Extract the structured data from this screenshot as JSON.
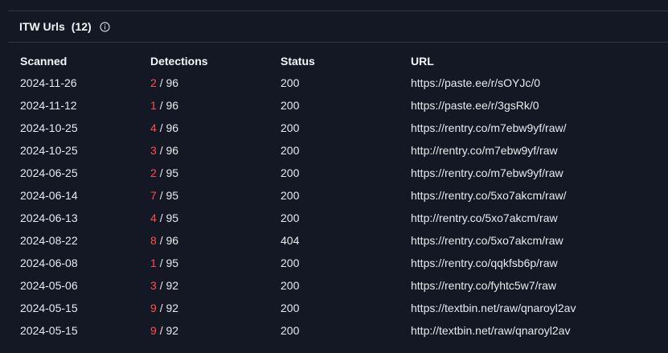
{
  "header": {
    "title": "ITW Urls",
    "count": "(12)",
    "info_icon": "info-circle-icon"
  },
  "table": {
    "columns": [
      "Scanned",
      "Detections",
      "Status",
      "URL"
    ],
    "rows": [
      {
        "scanned": "2024-11-26",
        "det": "2",
        "total": "/ 96",
        "status": "200",
        "url": "https://paste.ee/r/sOYJc/0"
      },
      {
        "scanned": "2024-11-12",
        "det": "1",
        "total": "/ 96",
        "status": "200",
        "url": "https://paste.ee/r/3gsRk/0"
      },
      {
        "scanned": "2024-10-25",
        "det": "4",
        "total": "/ 96",
        "status": "200",
        "url": "https://rentry.co/m7ebw9yf/raw/"
      },
      {
        "scanned": "2024-10-25",
        "det": "3",
        "total": "/ 96",
        "status": "200",
        "url": "http://rentry.co/m7ebw9yf/raw"
      },
      {
        "scanned": "2024-06-25",
        "det": "2",
        "total": "/ 95",
        "status": "200",
        "url": "https://rentry.co/m7ebw9yf/raw"
      },
      {
        "scanned": "2024-06-14",
        "det": "7",
        "total": "/ 95",
        "status": "200",
        "url": "https://rentry.co/5xo7akcm/raw/"
      },
      {
        "scanned": "2024-06-13",
        "det": "4",
        "total": "/ 95",
        "status": "200",
        "url": "http://rentry.co/5xo7akcm/raw"
      },
      {
        "scanned": "2024-08-22",
        "det": "8",
        "total": "/ 96",
        "status": "404",
        "url": "https://rentry.co/5xo7akcm/raw"
      },
      {
        "scanned": "2024-06-08",
        "det": "1",
        "total": "/ 95",
        "status": "200",
        "url": "https://rentry.co/qqkfsb6p/raw"
      },
      {
        "scanned": "2024-05-06",
        "det": "3",
        "total": "/ 92",
        "status": "200",
        "url": "https://rentry.co/fyhtc5w7/raw"
      },
      {
        "scanned": "2024-05-15",
        "det": "9",
        "total": "/ 92",
        "status": "200",
        "url": "https://textbin.net/raw/qnaroyl2av"
      },
      {
        "scanned": "2024-05-15",
        "det": "9",
        "total": "/ 92",
        "status": "200",
        "url": "http://textbin.net/raw/qnaroyl2av"
      }
    ]
  },
  "colors": {
    "background": "#141824",
    "detection_alert": "#ff4d4f",
    "text": "#e8eaf0"
  }
}
